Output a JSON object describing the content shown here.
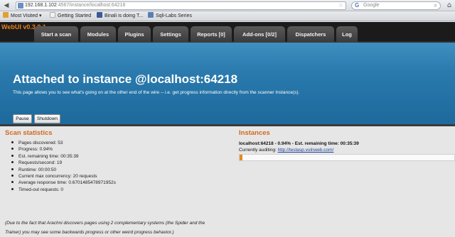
{
  "browser": {
    "url_host": "192.168.1.102",
    "url_path": ":4567/instance/localhost:64218",
    "search_placeholder": "Google",
    "bookmarks": [
      {
        "label": "Most Visited ▾",
        "color": "#e0a030"
      },
      {
        "label": "Getting Started",
        "color": "#f2f2f2"
      },
      {
        "label": "Binali is doing T...",
        "color": "#3b5998"
      },
      {
        "label": "Sqli-Labs Series",
        "color": "#5a7fb5"
      }
    ]
  },
  "app": {
    "brand": "WebUI v0.3.0.1",
    "tabs": [
      "Start a scan",
      "Modules",
      "Plugins",
      "Settings",
      "Reports [0]",
      "Add-ons [0/2]",
      "Dispatchers",
      "Log"
    ]
  },
  "hero": {
    "title": "Attached to instance @localhost:64218",
    "subtitle": "This page allows you to see what's going on at the other end of the wire -- i.e. get progress information directly from the scanner Instance(s)."
  },
  "actions": {
    "pause": "Pause",
    "shutdown": "Shutdown"
  },
  "stats": {
    "title": "Scan statistics",
    "items": [
      "Pages discovered: 53",
      "Progress: 0.94%",
      "Est. remaining time: 00:35:39",
      "Requests/second: 19",
      "Runtime: 00:00:50",
      "Current max concurrency: 20 requests",
      "Average response time: 0.6701485478971952s",
      "Timed-out requests: 0"
    ],
    "note_line1": "(Due to the fact that Arachni discovers pages using 2 complementary systems (the Spider and the",
    "note_line2": "Trainer) you may see some backwards progress or other weird progress behavior.)"
  },
  "instances": {
    "title": "Instances",
    "heading": "localhost:64218 - 0.94% - Est. remaining time: 00:35:39",
    "auditing_label": "Currently auditing:",
    "auditing_url": "http://testasp.vulnweb.com/",
    "progress_percent": 0.94
  },
  "colors": {
    "accent": "#d2691e",
    "brand": "#e87e1c",
    "hero": "#2a7aae",
    "progress": "#e8891c"
  }
}
